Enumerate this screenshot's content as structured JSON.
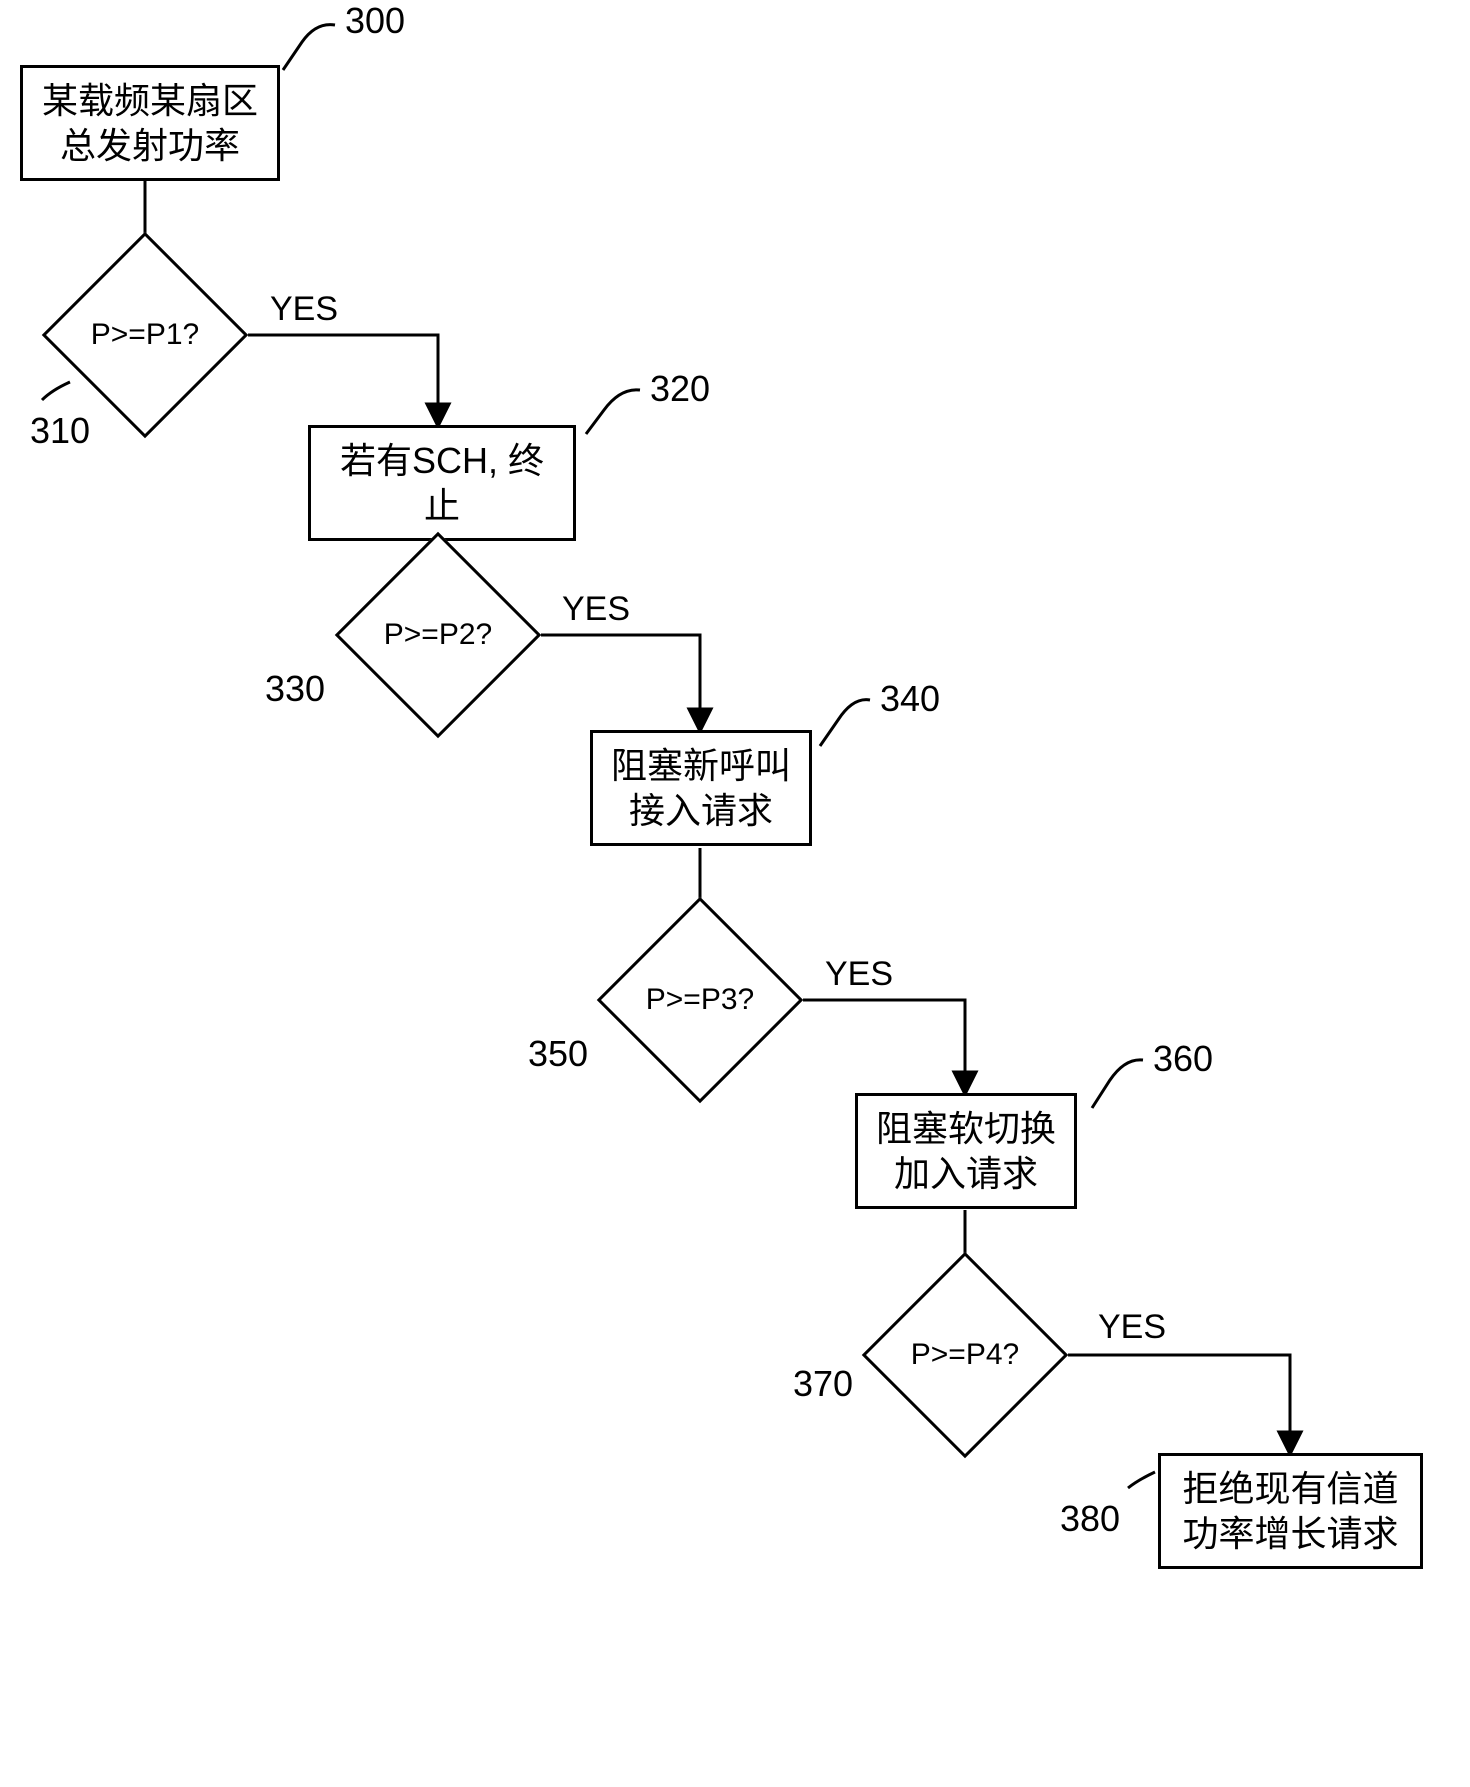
{
  "chart_data": {
    "type": "flowchart",
    "nodes": [
      {
        "id": "300",
        "kind": "process",
        "text": "某载频某扇区\n总发射功率"
      },
      {
        "id": "310",
        "kind": "decision",
        "text": "P>=P1?"
      },
      {
        "id": "320",
        "kind": "process",
        "text": "若有SCH, 终止"
      },
      {
        "id": "330",
        "kind": "decision",
        "text": "P>=P2?"
      },
      {
        "id": "340",
        "kind": "process",
        "text": "阻塞新呼叫\n接入请求"
      },
      {
        "id": "350",
        "kind": "decision",
        "text": "P>=P3?"
      },
      {
        "id": "360",
        "kind": "process",
        "text": "阻塞软切换\n加入请求"
      },
      {
        "id": "370",
        "kind": "decision",
        "text": "P>=P4?"
      },
      {
        "id": "380",
        "kind": "process",
        "text": "拒绝现有信道\n功率增长请求"
      }
    ],
    "edges": [
      {
        "from": "300",
        "to": "310",
        "label": ""
      },
      {
        "from": "310",
        "to": "320",
        "label": "YES"
      },
      {
        "from": "320",
        "to": "330",
        "label": ""
      },
      {
        "from": "330",
        "to": "340",
        "label": "YES"
      },
      {
        "from": "340",
        "to": "350",
        "label": ""
      },
      {
        "from": "350",
        "to": "360",
        "label": "YES"
      },
      {
        "from": "360",
        "to": "370",
        "label": ""
      },
      {
        "from": "370",
        "to": "380",
        "label": "YES"
      }
    ]
  },
  "labels": {
    "n300": "300",
    "n310": "310",
    "n320": "320",
    "n330": "330",
    "n340": "340",
    "n350": "350",
    "n360": "360",
    "n370": "370",
    "n380": "380",
    "yes": "YES"
  },
  "boxes": {
    "b300_l1": "某载频某扇区",
    "b300_l2": "总发射功率",
    "d310": "P>=P1?",
    "b320": "若有SCH, 终止",
    "d330": "P>=P2?",
    "b340_l1": "阻塞新呼叫",
    "b340_l2": "接入请求",
    "d350": "P>=P3?",
    "b360_l1": "阻塞软切换",
    "b360_l2": "加入请求",
    "d370": "P>=P4?",
    "b380_l1": "拒绝现有信道",
    "b380_l2": "功率增长请求"
  }
}
